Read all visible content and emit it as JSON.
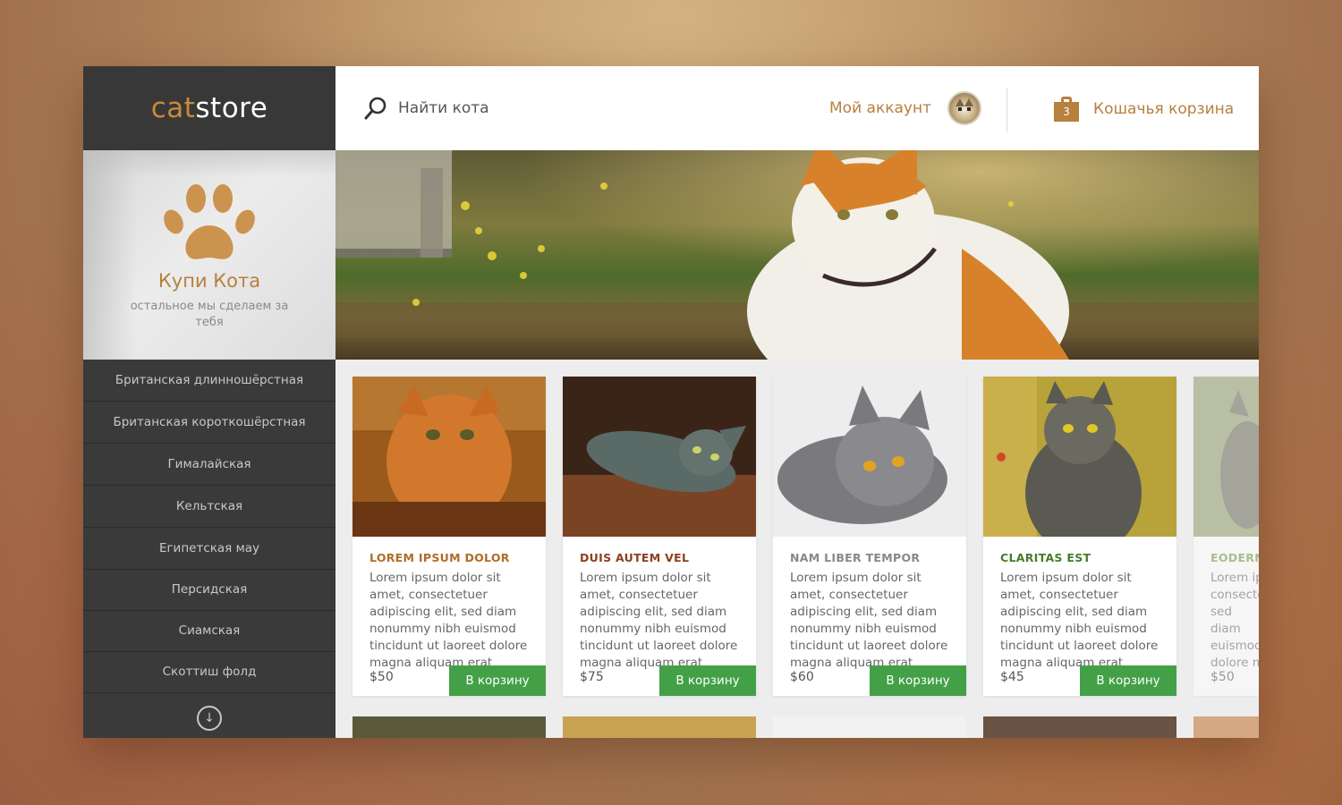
{
  "logo": {
    "part1": "cat",
    "part2": "store"
  },
  "promo": {
    "title": "Купи Кота",
    "subtitle": "остальное мы сделаем за тебя"
  },
  "menu": {
    "items": [
      "Британская длинношёрстная",
      "Британская короткошёрстная",
      "Гималайская",
      "Кельтская",
      "Египетская мау",
      "Персидская",
      "Сиамская",
      "Скоттиш фолд"
    ],
    "scroll_icon": "arrow-down-circle-icon"
  },
  "header": {
    "search_placeholder": "Найти кота",
    "account_label": "Мой аккаунт",
    "cart_label": "Кошачья корзина",
    "cart_count": "3"
  },
  "colors": {
    "accent": "#b7803d",
    "button": "#43a047",
    "sidebar": "#3a3a3a"
  },
  "products": [
    {
      "title": "LOREM IPSUM DOLOR",
      "description": "Lorem ipsum dolor sit amet, consectetuer adipiscing elit, sed diam nonummy nibh euismod tincidunt ut laoreet dolore magna aliquam erat",
      "price": "$50",
      "button": "В корзину"
    },
    {
      "title": "DUIS AUTEM VEL",
      "description": "Lorem ipsum dolor sit amet, consectetuer adipiscing elit, sed diam nonummy nibh euismod tincidunt ut laoreet dolore magna aliquam erat",
      "price": "$75",
      "button": "В корзину"
    },
    {
      "title": "NAM LIBER TEMPOR",
      "description": "Lorem ipsum dolor sit amet, consectetuer adipiscing elit, sed diam nonummy nibh euismod tincidunt ut laoreet dolore magna aliquam erat",
      "price": "$60",
      "button": "В корзину"
    },
    {
      "title": "CLARITAS EST",
      "description": "Lorem ipsum dolor sit amet, consectetuer adipiscing elit, sed diam nonummy nibh euismod tincidunt ut laoreet dolore magna aliquam erat",
      "price": "$45",
      "button": "В корзину"
    },
    {
      "title": "EODERN",
      "description": "Lorem ip consecte sed diam euismod dolore m",
      "price": "$50"
    }
  ]
}
